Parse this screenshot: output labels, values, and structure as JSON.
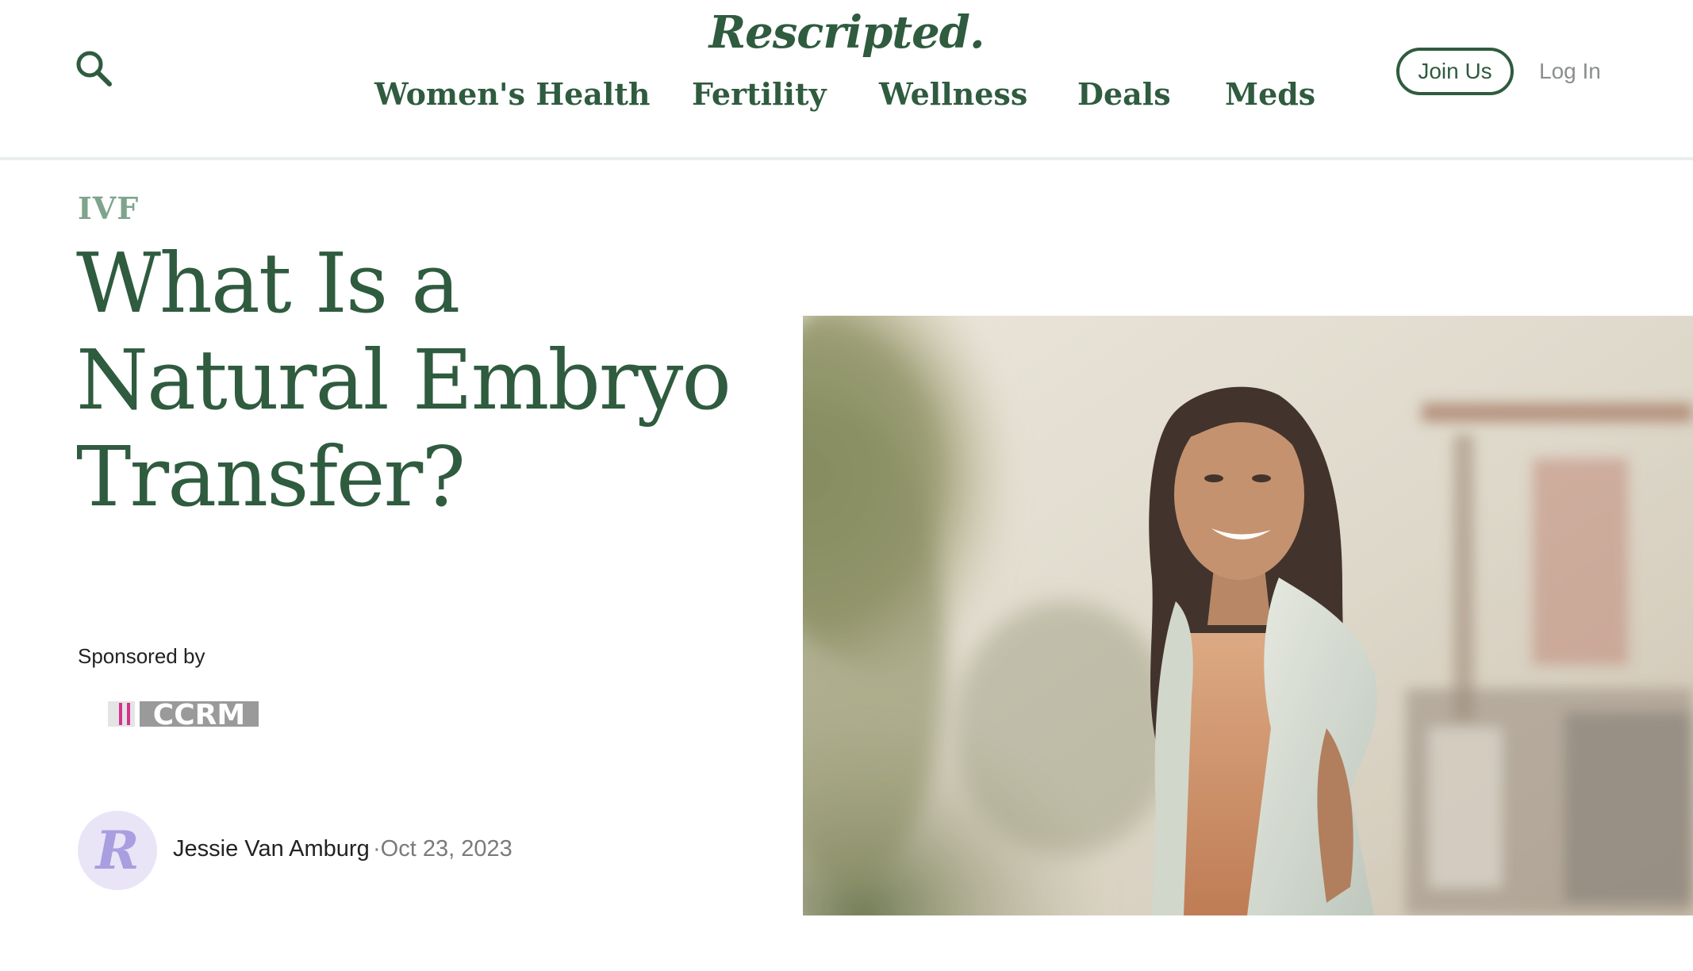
{
  "header": {
    "logo": "Rescripted.",
    "search_icon": "search-icon",
    "nav": [
      {
        "label": "Women's Health"
      },
      {
        "label": "Fertility"
      },
      {
        "label": "Wellness"
      },
      {
        "label": "Deals"
      },
      {
        "label": "Meds"
      }
    ],
    "join_label": "Join Us",
    "login_label": "Log In"
  },
  "article": {
    "category": "IVF",
    "title": "What Is a Natural Embryo Transfer?",
    "sponsored_label": "Sponsored by",
    "sponsor_name": "CCRM",
    "author_avatar_letter": "R",
    "author": "Jessie Van Amburg",
    "date": "·Oct 23, 2023"
  },
  "colors": {
    "brand_green": "#2f5b3f",
    "category_green": "#7fa48d",
    "avatar_bg": "#e9e5f7",
    "sponsor_pink": "#d6318d"
  }
}
